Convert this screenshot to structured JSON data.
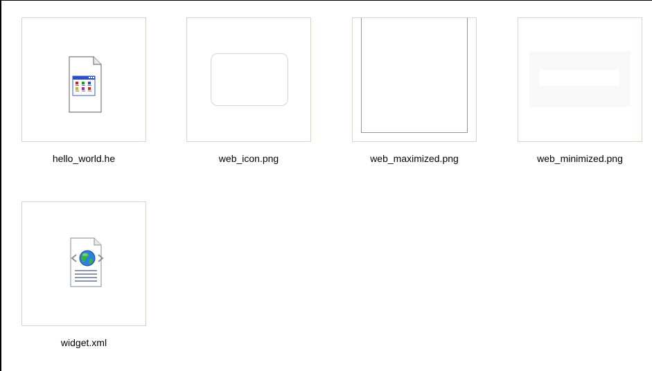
{
  "files": [
    {
      "name": "hello_world.he",
      "icon": "application-document-icon"
    },
    {
      "name": "web_icon.png",
      "icon": "rounded-rect-thumbnail"
    },
    {
      "name": "web_maximized.png",
      "icon": "maximized-window-thumbnail"
    },
    {
      "name": "web_minimized.png",
      "icon": "minimized-bar-thumbnail"
    },
    {
      "name": "widget.xml",
      "icon": "xml-globe-document-icon"
    }
  ],
  "colors": {
    "thumb_border": "#d7d4c6",
    "window_border": "#8a96a6",
    "background": "#ffffff"
  }
}
